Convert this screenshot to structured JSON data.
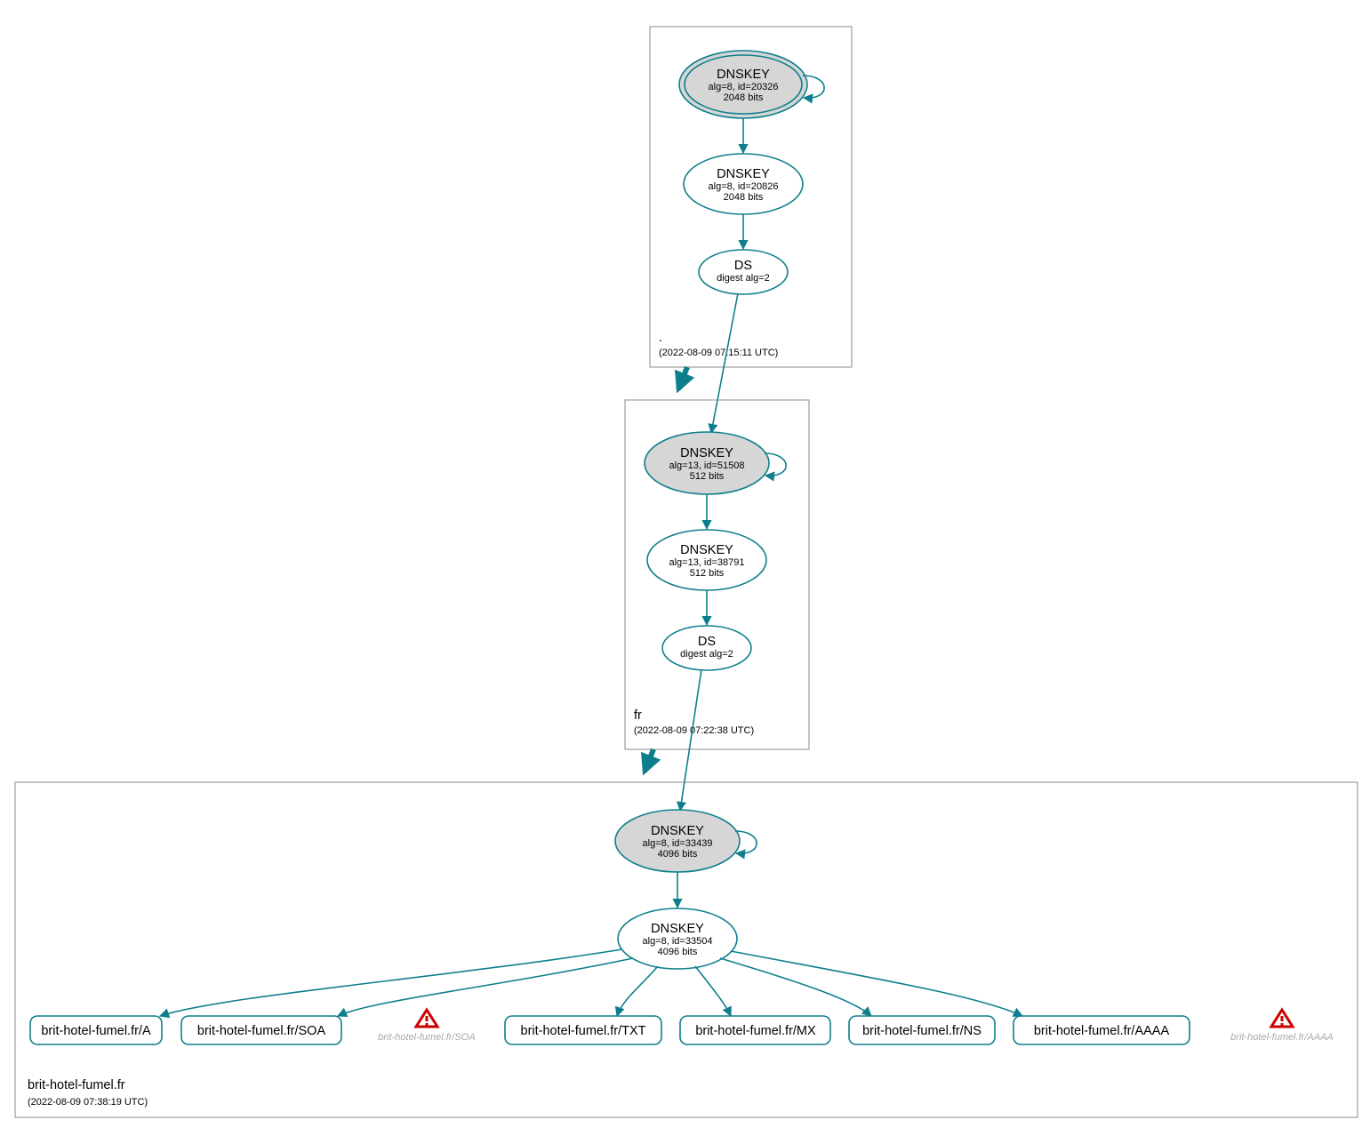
{
  "colors": {
    "stroke": "#0d7f8c",
    "ksk_fill": "#d6d6d6",
    "warn": "#cc0000",
    "warn_text": "#aaaaaa"
  },
  "zones": {
    "root": {
      "label": ".",
      "timestamp": "(2022-08-09 07:15:11 UTC)",
      "dnskey_ksk": {
        "title": "DNSKEY",
        "line1": "alg=8, id=20326",
        "line2": "2048 bits"
      },
      "dnskey_zsk": {
        "title": "DNSKEY",
        "line1": "alg=8, id=20826",
        "line2": "2048 bits"
      },
      "ds": {
        "title": "DS",
        "line1": "digest alg=2"
      }
    },
    "fr": {
      "label": "fr",
      "timestamp": "(2022-08-09 07:22:38 UTC)",
      "dnskey_ksk": {
        "title": "DNSKEY",
        "line1": "alg=13, id=51508",
        "line2": "512 bits"
      },
      "dnskey_zsk": {
        "title": "DNSKEY",
        "line1": "alg=13, id=38791",
        "line2": "512 bits"
      },
      "ds": {
        "title": "DS",
        "line1": "digest alg=2"
      }
    },
    "domain": {
      "label": "brit-hotel-fumel.fr",
      "timestamp": "(2022-08-09 07:38:19 UTC)",
      "dnskey_ksk": {
        "title": "DNSKEY",
        "line1": "alg=8, id=33439",
        "line2": "4096 bits"
      },
      "dnskey_zsk": {
        "title": "DNSKEY",
        "line1": "alg=8, id=33504",
        "line2": "4096 bits"
      }
    }
  },
  "rrsets": {
    "a": "brit-hotel-fumel.fr/A",
    "soa": "brit-hotel-fumel.fr/SOA",
    "txt": "brit-hotel-fumel.fr/TXT",
    "mx": "brit-hotel-fumel.fr/MX",
    "ns": "brit-hotel-fumel.fr/NS",
    "aaaa": "brit-hotel-fumel.fr/AAAA"
  },
  "warnings": {
    "soa": "brit-hotel-fumel.fr/SOA",
    "aaaa": "brit-hotel-fumel.fr/AAAA"
  }
}
